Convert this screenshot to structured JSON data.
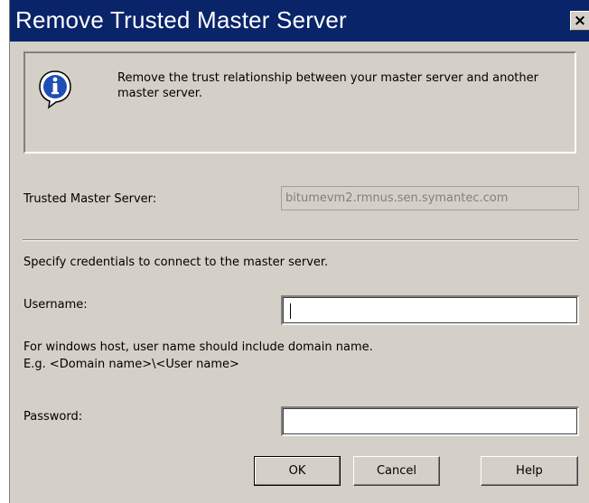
{
  "window": {
    "title": "Remove Trusted Master Server",
    "close_label": "×"
  },
  "info": {
    "icon": "info-icon",
    "message": "Remove the trust relationship between your master server and another master server."
  },
  "form": {
    "trusted_master_label": "Trusted Master Server:",
    "trusted_master_value": "bitumevm2.rmnus.sen.symantec.com",
    "credentials_prompt": "Specify credentials to connect to the master server.",
    "username_label": "Username:",
    "username_value": "",
    "hint_line1": "For windows host, user name should include domain name.",
    "hint_line2": "E.g. <Domain name>\\<User name>",
    "password_label": "Password:",
    "password_value": ""
  },
  "buttons": {
    "ok": "OK",
    "cancel": "Cancel",
    "help": "Help"
  },
  "colors": {
    "titlebar": "#0a246a",
    "dialog_bg": "#d4d0c8",
    "disabled_text": "#808080"
  }
}
